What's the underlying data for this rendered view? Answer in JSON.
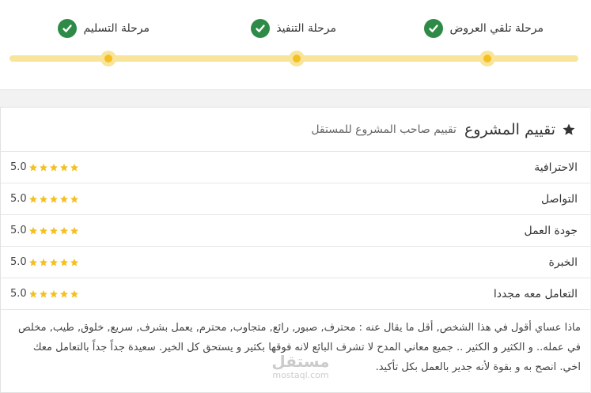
{
  "stages": [
    {
      "label": "مرحلة تلقي العروض",
      "done": true
    },
    {
      "label": "مرحلة التنفيذ",
      "done": true
    },
    {
      "label": "مرحلة التسليم",
      "done": true
    }
  ],
  "rating": {
    "title": "تقييم المشروع",
    "subtitle": "تقييم صاحب المشروع للمستقل",
    "criteria": [
      {
        "label": "الاحترافية",
        "score": "5.0",
        "stars": 5
      },
      {
        "label": "التواصل",
        "score": "5.0",
        "stars": 5
      },
      {
        "label": "جودة العمل",
        "score": "5.0",
        "stars": 5
      },
      {
        "label": "الخبرة",
        "score": "5.0",
        "stars": 5
      },
      {
        "label": "التعامل معه مجددا",
        "score": "5.0",
        "stars": 5
      }
    ],
    "review": "ماذا عساي أقول في هذا الشخص, أقل ما يقال عنه : محترف, صبور, رائع, متجاوب, محترم, يعمل بشرف, سريع, خلوق, طيب, مخلص في عمله.. و الكثير و الكثير .. جميع معاني المدح لا تشرف البائع لانه فوقها بكثير و يستحق كل الخير. سعيدة جداً جداً بالتعامل معك اخي. انصح به و بقوة لأنه جدير بالعمل بكل تأكيد."
  },
  "watermark": {
    "logo": "مستقل",
    "url": "mostaql.com"
  },
  "colors": {
    "check": "#2e8b47",
    "track": "#f8e49b",
    "dot": "#f4c021",
    "star": "#f4c021"
  }
}
